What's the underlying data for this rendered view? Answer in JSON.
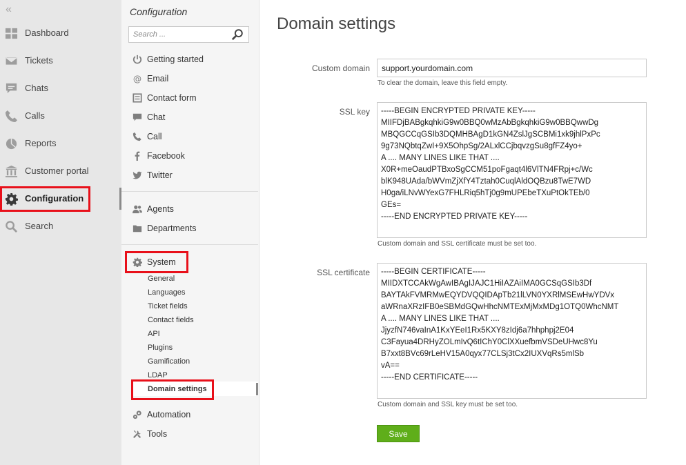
{
  "leftnav": {
    "items": [
      {
        "label": "Dashboard",
        "icon": "dashboard-icon"
      },
      {
        "label": "Tickets",
        "icon": "envelope-icon"
      },
      {
        "label": "Chats",
        "icon": "chat-bubble-icon"
      },
      {
        "label": "Calls",
        "icon": "phone-icon"
      },
      {
        "label": "Reports",
        "icon": "pie-chart-icon"
      },
      {
        "label": "Customer portal",
        "icon": "building-icon"
      },
      {
        "label": "Configuration",
        "icon": "gear-icon"
      },
      {
        "label": "Search",
        "icon": "search-icon"
      }
    ]
  },
  "midpanel": {
    "title": "Configuration",
    "search_placeholder": "Search ...",
    "channels": [
      "Getting started",
      "Email",
      "Contact form",
      "Chat",
      "Call",
      "Facebook",
      "Twitter"
    ],
    "people": [
      "Agents",
      "Departments"
    ],
    "system_label": "System",
    "system_items": [
      "General",
      "Languages",
      "Ticket fields",
      "Contact fields",
      "API",
      "Plugins",
      "Gamification",
      "LDAP",
      "Domain settings"
    ],
    "automation_label": "Automation",
    "tools_label": "Tools"
  },
  "content": {
    "title": "Domain settings",
    "custom_domain_label": "Custom domain",
    "custom_domain_value": "support.yourdomain.com",
    "custom_domain_hint": "To clear the domain, leave this field empty.",
    "ssl_key_label": "SSL key",
    "ssl_key_value": "-----BEGIN ENCRYPTED PRIVATE KEY-----\nMIIFDjBABgkqhkiG9w0BBQ0wMzAbBgkqhkiG9w0BBQwwDg\nMBQGCCqGSIb3DQMHBAgD1kGN4ZslJgSCBMi1xk9jhlPxPc\n9g73NQbtqZwI+9X5OhpSg/2ALxlCCjbqvzgSu8gfFZ4yo+\nA .... MANY LINES LIKE THAT ....\nX0R+meOaudPTBxoSgCCM51poFgaqt4l6VlTN4FRpj+c/Wc\nblK948UAda/bWVmZjXfY4Tztah0CuqlAldOQBzu8TwE7WD\nH0ga/iLNvWYexG7FHLRiq5hTj0g9mUPEbeTXuPtOkTEb/0\nGEs=\n-----END ENCRYPTED PRIVATE KEY-----",
    "ssl_key_hint": "Custom domain and SSL certificate must be set too.",
    "ssl_cert_label": "SSL certificate",
    "ssl_cert_value": "-----BEGIN CERTIFICATE-----\nMIIDXTCCAkWgAwIBAgIJAJC1HiIAZAiIMA0GCSqGSIb3Df\nBAYTAkFVMRMwEQYDVQQIDApTb21lLVN0YXRlMSEwHwYDVx\naWRnaXRzIFB0eSBMdGQwHhcNMTExMjMxMDg1OTQ0WhcNMT\nA .... MANY LINES LIKE THAT ....\nJjyzfN746vaInA1KxYEeI1Rx5KXY8zIdj6a7hhphpj2E04\nC3Fayua4DRHyZOLmIvQ6tIChY0ClXXuefbmVSDeUHwc8Yu\nB7xxt8BVc69rLeHV15A0qyx77CLSj3tCx2IUXVqRs5mlSb\nvA==\n-----END CERTIFICATE-----",
    "ssl_cert_hint": "Custom domain and SSL key must be set too.",
    "save_label": "Save"
  },
  "colors": {
    "highlight": "#e8101a",
    "save_button": "#5fae1a"
  }
}
